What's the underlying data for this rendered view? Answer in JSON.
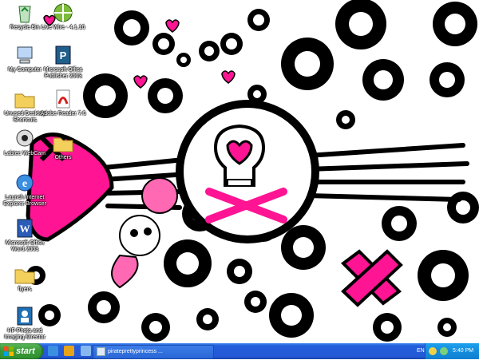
{
  "desktop": {
    "icons": [
      {
        "label": "Recycle Bin",
        "icon": "recycle-bin-icon"
      },
      {
        "label": "Live Wire - 4.1.10",
        "icon": "livewire-icon"
      },
      {
        "label": "My Computer",
        "icon": "my-computer-icon"
      },
      {
        "label": "Microsoft Office Publisher 2003",
        "icon": "publisher-icon"
      },
      {
        "label": "Unused Desktop Shortcuts",
        "icon": "folder-icon"
      },
      {
        "label": "Adobe Reader 7.0",
        "icon": "adobe-reader-icon"
      },
      {
        "label": "Labtec WebCam",
        "icon": "webcam-icon"
      },
      {
        "label": "Others",
        "icon": "folder-icon"
      },
      {
        "label": "Launch Internet Explorer Browser",
        "icon": "internet-explorer-icon"
      },
      {
        "label": "Microsoft Office Word 2003",
        "icon": "word-icon"
      },
      {
        "label": "flyers",
        "icon": "folder-icon"
      },
      {
        "label": "HP Photo and Imaging Director",
        "icon": "hp-director-icon"
      }
    ]
  },
  "taskbar": {
    "start_label": "start",
    "task_label": "pirateprettyprincess ...",
    "language": "EN",
    "clock": "5:40 PM"
  },
  "colors": {
    "pink": "#ff1493",
    "taskbar_blue": "#245edb",
    "start_green": "#3c9c3c",
    "tray_blue": "#1590e0"
  }
}
